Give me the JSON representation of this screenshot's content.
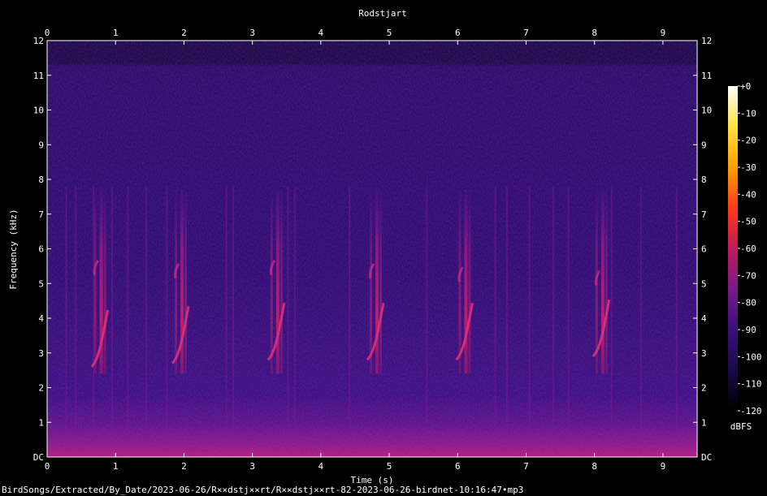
{
  "chart_data": {
    "type": "heatmap",
    "title": "Rodstjart",
    "xlabel": "Time (s)",
    "ylabel": "Frequency (kHz)",
    "x_ticks": [
      "0",
      "1",
      "2",
      "3",
      "4",
      "5",
      "6",
      "7",
      "8",
      "9"
    ],
    "y_ticks": [
      "DC",
      "1",
      "2",
      "3",
      "4",
      "5",
      "6",
      "7",
      "8",
      "9",
      "10",
      "11",
      "12"
    ],
    "xlim": [
      0,
      9.5
    ],
    "ylim": [
      0,
      12
    ],
    "colorbar": {
      "label": "dBFS",
      "ticks": [
        "+0",
        "-10",
        "-20",
        "-30",
        "-40",
        "-50",
        "-60",
        "-70",
        "-80",
        "-90",
        "-100",
        "-110",
        "-120"
      ],
      "range": [
        -120,
        0
      ],
      "colors": [
        "#000000",
        "#1a0a4a",
        "#3b0f7a",
        "#7a1a8a",
        "#c01a5a",
        "#ff3a1a",
        "#ffa000",
        "#ffe040",
        "#ffffff"
      ]
    },
    "calls": [
      {
        "time": 0.72,
        "f_low": 2.6,
        "f_high": 5.9
      },
      {
        "time": 1.9,
        "f_low": 2.7,
        "f_high": 5.8
      },
      {
        "time": 3.3,
        "f_low": 2.8,
        "f_high": 5.9
      },
      {
        "time": 4.75,
        "f_low": 2.8,
        "f_high": 5.8
      },
      {
        "time": 6.05,
        "f_low": 2.8,
        "f_high": 5.7
      },
      {
        "time": 8.05,
        "f_low": 2.9,
        "f_high": 5.6
      }
    ],
    "broadband_lines_s": [
      0.28,
      0.42,
      0.68,
      0.95,
      1.18,
      1.45,
      1.75,
      2.62,
      2.72,
      3.52,
      3.62,
      4.42,
      5.55,
      6.55,
      6.72,
      7.05,
      7.4,
      7.62,
      8.25,
      8.68,
      9.2
    ]
  },
  "footer": {
    "path": "BirdSongs/Extracted/By_Date/2023-06-26/R××dstj××rt/R××dstj××rt-82-2023-06-26-birdnet-10:16:47•mp3"
  }
}
